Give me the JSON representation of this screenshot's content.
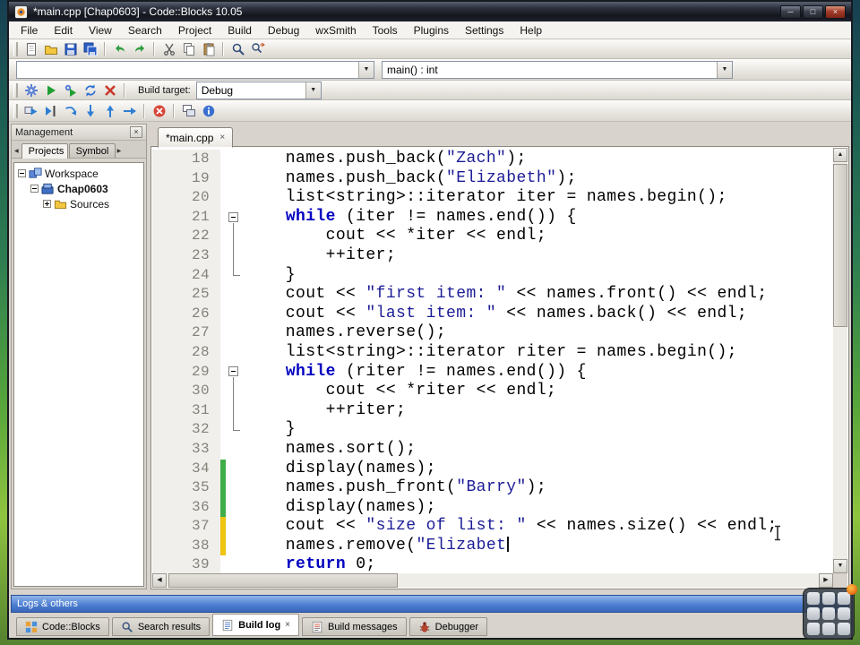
{
  "window": {
    "title": "*main.cpp [Chap0603] - Code::Blocks 10.05"
  },
  "glyphs": {
    "close": "×",
    "minimize": "─",
    "maximize": "□",
    "up": "▲",
    "down": "▼",
    "left": "◀",
    "right": "▶"
  },
  "menu": [
    "File",
    "Edit",
    "View",
    "Search",
    "Project",
    "Build",
    "Debug",
    "wxSmith",
    "Tools",
    "Plugins",
    "Settings",
    "Help"
  ],
  "toolbars": {
    "scope_combo_value": "",
    "symbol_combo_value": "main() : int",
    "main": [
      "new-file-icon",
      "open-file-icon",
      "save-icon",
      "save-all-icon",
      "sep",
      "undo-icon",
      "redo-icon",
      "sep",
      "cut-icon",
      "copy-icon",
      "paste-icon",
      "sep",
      "find-icon",
      "replace-icon"
    ],
    "compile": [
      "build-icon",
      "run-icon",
      "build-and-run-icon",
      "rebuild-icon",
      "abort-icon",
      "sep"
    ],
    "debug": [
      "debug-continue-icon",
      "run-to-cursor-icon",
      "next-line-icon",
      "step-into-icon",
      "step-out-icon",
      "next-instruction-icon",
      "sep",
      "stop-debugger-icon",
      "sep",
      "debugging-windows-icon",
      "various-info-icon"
    ]
  },
  "build": {
    "target_label": "Build target:",
    "target_value": "Debug"
  },
  "management": {
    "title": "Management",
    "tabs": [
      {
        "label": "Projects",
        "active": true
      },
      {
        "label": "Symbol",
        "active": false
      }
    ],
    "tree": [
      {
        "label": "Workspace",
        "level": 0,
        "expander": "minus",
        "icon": "workspace-icon",
        "bold": false
      },
      {
        "label": "Chap0603",
        "level": 1,
        "expander": "minus",
        "icon": "project-icon",
        "bold": true
      },
      {
        "label": "Sources",
        "level": 2,
        "expander": "plus",
        "icon": "folder-icon",
        "bold": false
      }
    ]
  },
  "editor": {
    "tab_label": "*main.cpp",
    "lines": [
      {
        "n": 18,
        "seg": [
          [
            "    names.push_back(",
            "p"
          ],
          [
            "\"Zach\"",
            "s"
          ],
          [
            ");",
            "p"
          ]
        ]
      },
      {
        "n": 19,
        "seg": [
          [
            "    names.push_back(",
            "p"
          ],
          [
            "\"Elizabeth\"",
            "s"
          ],
          [
            ");",
            "p"
          ]
        ]
      },
      {
        "n": 20,
        "seg": [
          [
            "    list<string>::iterator iter = names.begin();",
            "p"
          ]
        ]
      },
      {
        "n": 21,
        "fold": "start",
        "seg": [
          [
            "    ",
            "p"
          ],
          [
            "while",
            "k"
          ],
          [
            " (iter != names.end()) {",
            "p"
          ]
        ]
      },
      {
        "n": 22,
        "fold": "mid",
        "seg": [
          [
            "        cout << *iter << endl;",
            "p"
          ]
        ]
      },
      {
        "n": 23,
        "fold": "mid",
        "seg": [
          [
            "        ++iter;",
            "p"
          ]
        ]
      },
      {
        "n": 24,
        "fold": "end",
        "seg": [
          [
            "    }",
            "p"
          ]
        ]
      },
      {
        "n": 25,
        "seg": [
          [
            "    cout << ",
            "p"
          ],
          [
            "\"first item: \"",
            "s"
          ],
          [
            " << names.front() << endl;",
            "p"
          ]
        ]
      },
      {
        "n": 26,
        "seg": [
          [
            "    cout << ",
            "p"
          ],
          [
            "\"last item: \"",
            "s"
          ],
          [
            " << names.back() << endl;",
            "p"
          ]
        ]
      },
      {
        "n": 27,
        "seg": [
          [
            "    names.reverse();",
            "p"
          ]
        ]
      },
      {
        "n": 28,
        "seg": [
          [
            "    list<string>::iterator riter = names.begin();",
            "p"
          ]
        ]
      },
      {
        "n": 29,
        "fold": "start",
        "seg": [
          [
            "    ",
            "p"
          ],
          [
            "while",
            "k"
          ],
          [
            " (riter != names.end()) {",
            "p"
          ]
        ]
      },
      {
        "n": 30,
        "fold": "mid",
        "seg": [
          [
            "        cout << *riter << endl;",
            "p"
          ]
        ]
      },
      {
        "n": 31,
        "fold": "mid",
        "seg": [
          [
            "        ++riter;",
            "p"
          ]
        ]
      },
      {
        "n": 32,
        "fold": "end",
        "seg": [
          [
            "    }",
            "p"
          ]
        ]
      },
      {
        "n": 33,
        "seg": [
          [
            "    names.sort();",
            "p"
          ]
        ]
      },
      {
        "n": 34,
        "mark": "g",
        "seg": [
          [
            "    display(names);",
            "p"
          ]
        ]
      },
      {
        "n": 35,
        "mark": "g",
        "seg": [
          [
            "    names.push_front(",
            "p"
          ],
          [
            "\"Barry\"",
            "s"
          ],
          [
            ");",
            "p"
          ]
        ]
      },
      {
        "n": 36,
        "mark": "g",
        "seg": [
          [
            "    display(names);",
            "p"
          ]
        ]
      },
      {
        "n": 37,
        "mark": "y",
        "seg": [
          [
            "    cout << ",
            "p"
          ],
          [
            "\"size of list: \"",
            "s"
          ],
          [
            " << names.size() << endl;",
            "p"
          ]
        ]
      },
      {
        "n": 38,
        "mark": "y",
        "caret": true,
        "seg": [
          [
            "    names.remove(",
            "p"
          ],
          [
            "\"Elizabet",
            "s"
          ]
        ]
      },
      {
        "n": 39,
        "seg": [
          [
            "    ",
            "p"
          ],
          [
            "return",
            "k"
          ],
          [
            " 0;",
            "p"
          ]
        ]
      }
    ]
  },
  "logs": {
    "title": "Logs & others",
    "tabs": [
      {
        "label": "Code::Blocks",
        "icon": "codeblocks-icon",
        "active": false,
        "closable": false
      },
      {
        "label": "Search results",
        "icon": "search-icon",
        "active": false,
        "closable": false
      },
      {
        "label": "Build log",
        "icon": "build-log-icon",
        "active": true,
        "closable": true
      },
      {
        "label": "Build messages",
        "icon": "build-messages-icon",
        "active": false,
        "closable": false
      },
      {
        "label": "Debugger",
        "icon": "debugger-icon",
        "active": false,
        "closable": false
      }
    ]
  }
}
